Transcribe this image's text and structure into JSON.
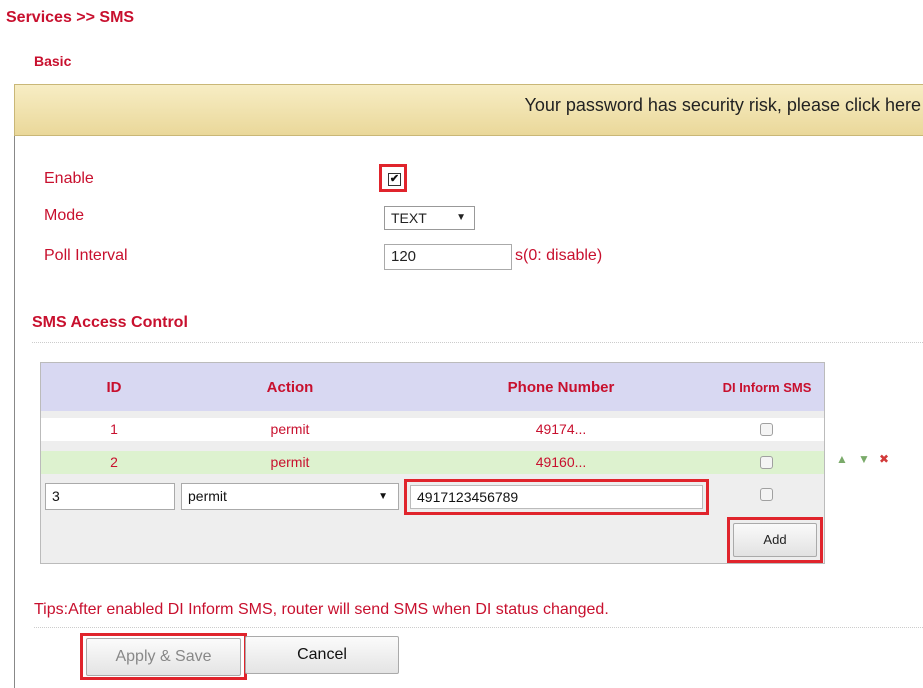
{
  "breadcrumb": "Services >> SMS",
  "section_basic": "Basic",
  "warning": "Your password has security risk, please click here",
  "form": {
    "enable_label": "Enable",
    "enable_checked": true,
    "mode_label": "Mode",
    "mode_value": "TEXT",
    "poll_label": "Poll Interval",
    "poll_value": "120",
    "poll_unit": "s(0: disable)"
  },
  "access_control": {
    "title": "SMS Access Control",
    "headers": [
      "ID",
      "Action",
      "Phone Number",
      "DI Inform SMS"
    ],
    "rows": [
      {
        "id": "1",
        "action": "permit",
        "phone": "49174...",
        "di_inform": false
      },
      {
        "id": "2",
        "action": "permit",
        "phone": "49160...",
        "di_inform": false
      }
    ],
    "new_row": {
      "id": "3",
      "action": "permit",
      "phone": "4917123456789",
      "di_inform": false
    },
    "add_label": "Add",
    "row_controls": {
      "up": "▲",
      "down": "▼",
      "delete": "✖"
    }
  },
  "tips": "Tips:After enabled DI Inform SMS, router will send SMS when DI status changed.",
  "buttons": {
    "apply": "Apply & Save",
    "cancel": "Cancel"
  },
  "colors": {
    "accent": "#c8102e",
    "highlight": "#e0242c",
    "header_bg": "#d8d8f2",
    "row_alt": "#ddf2cf"
  }
}
